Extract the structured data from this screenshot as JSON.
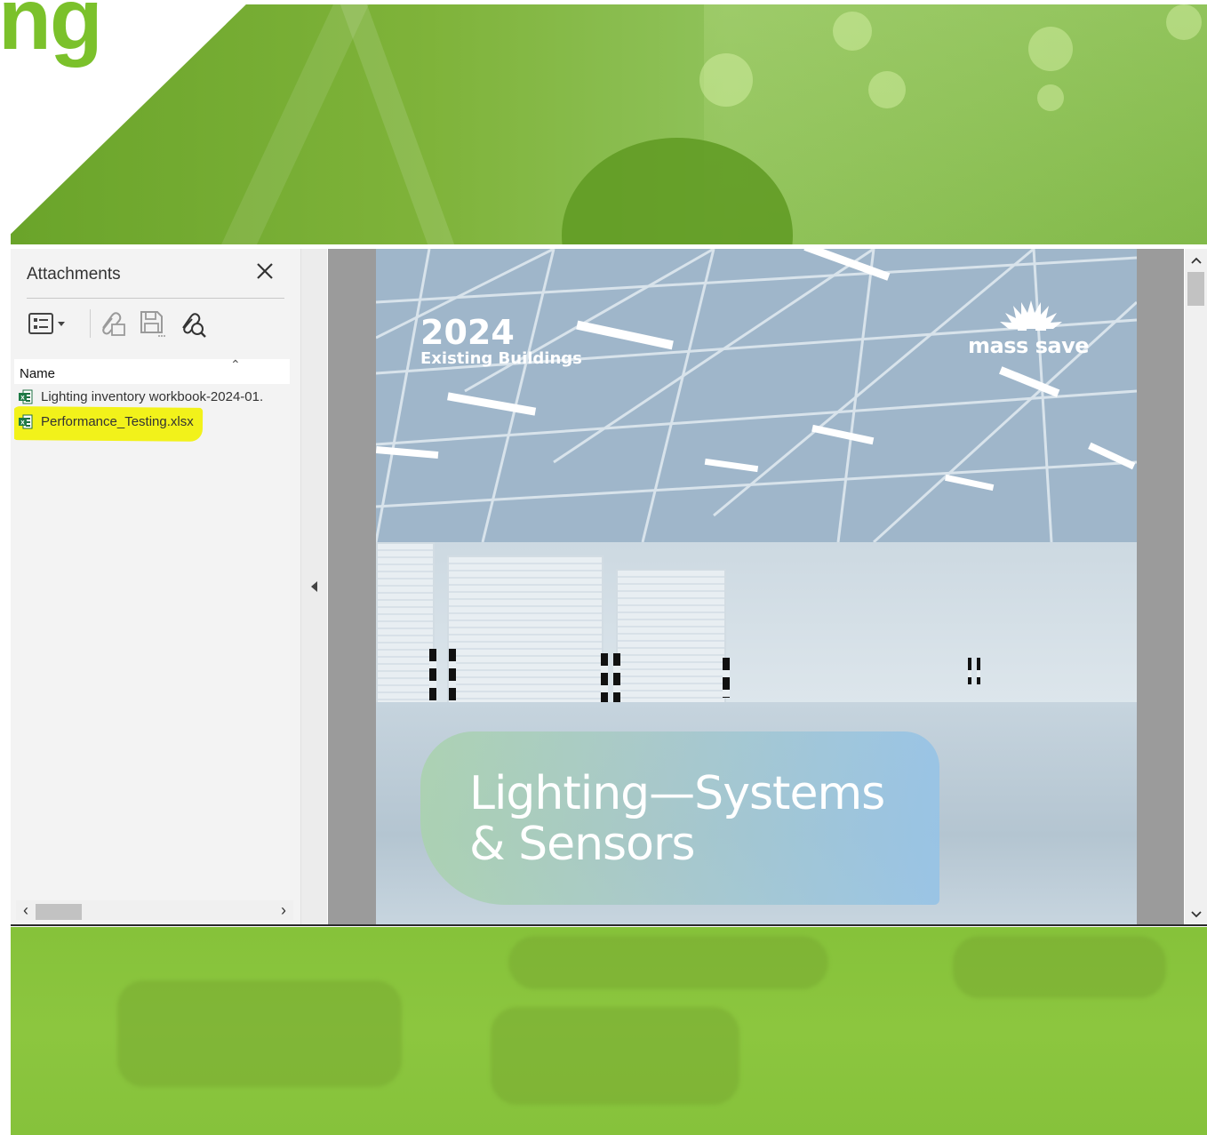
{
  "website": {
    "brand_fragment": "ng"
  },
  "attachments_panel": {
    "title": "Attachments",
    "toolbar": {
      "options_icon": "list-options-icon",
      "attach_icon": "add-attachment-icon",
      "save_icon": "save-attachment-icon",
      "search_icon": "search-attachment-icon"
    },
    "list_header": {
      "name": "Name"
    },
    "files": [
      {
        "name": "Lighting inventory workbook-2024-01.",
        "icon": "excel-file-icon",
        "highlighted": false
      },
      {
        "name": "Performance_Testing.xlsx",
        "icon": "excel-file-icon",
        "highlighted": true
      }
    ],
    "highlight_color": "#f2f21a"
  },
  "document": {
    "year": "2024",
    "subtitle": "Existing Buildings",
    "brand": "mass save",
    "title_line1": "Lighting—Systems",
    "title_line2": "& Sensors"
  },
  "colors": {
    "brand_green": "#7bc12b",
    "banner_green": "#86c23a",
    "viewer_gray": "#9b9b9b"
  }
}
